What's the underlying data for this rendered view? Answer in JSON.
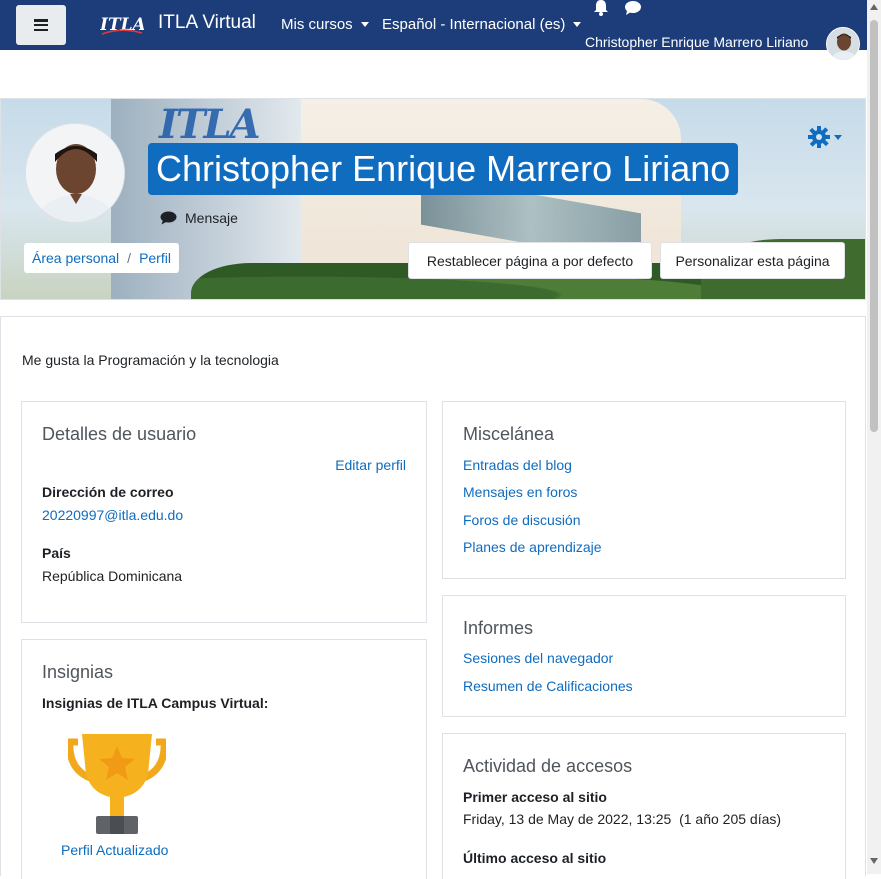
{
  "navbar": {
    "brand": "ITLA Virtual",
    "logo_text": "ITLA",
    "my_courses": "Mis cursos",
    "language": "Español - Internacional (es)",
    "user_name": "Christopher Enrique Marrero Liriano",
    "icons": [
      "menu-icon",
      "bell-icon",
      "chat-icon"
    ]
  },
  "header": {
    "full_name": "Christopher Enrique Marrero Liriano",
    "message_label": "Mensaje",
    "breadcrumb": [
      "Área personal",
      "Perfil"
    ],
    "breadcrumb_separator": "/",
    "reset_button": "Restablecer página a por defecto",
    "customize_button": "Personalizar esta página"
  },
  "profile": {
    "description": "Me gusta la Programación y la tecnologia"
  },
  "user_details": {
    "title": "Detalles de usuario",
    "edit_link": "Editar perfil",
    "email_label": "Dirección de correo",
    "email_value": "20220997@itla.edu.do",
    "country_label": "País",
    "country_value": "República Dominicana"
  },
  "badges": {
    "title": "Insignias",
    "subtitle": "Insignias de ITLA Campus Virtual:",
    "badge_name": "Perfil Actualizado"
  },
  "misc": {
    "title": "Miscelánea",
    "links": [
      "Entradas del blog",
      "Mensajes en foros",
      "Foros de discusión",
      "Planes de aprendizaje"
    ]
  },
  "reports": {
    "title": "Informes",
    "links": [
      "Sesiones del navegador",
      "Resumen de Calificaciones"
    ]
  },
  "access": {
    "title": "Actividad de accesos",
    "first_label": "Primer acceso al sitio",
    "first_value": "Friday, 13 de May de 2022, 13:25  (1 año 205 días)",
    "last_label": "Último acceso al sitio"
  },
  "colors": {
    "navbar": "#1d3d7a",
    "accent": "#0f6cbf"
  }
}
